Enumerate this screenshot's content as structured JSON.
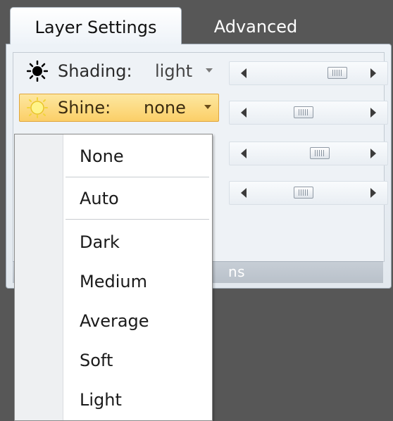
{
  "tabs": [
    {
      "label": "Layer Settings",
      "active": true
    },
    {
      "label": "Advanced",
      "active": false
    }
  ],
  "properties": {
    "shading": {
      "label": "Shading:",
      "value": "light",
      "icon": "black-sun-icon"
    },
    "shine": {
      "label": "Shine:",
      "value": "none",
      "icon": "yellow-sun-icon",
      "highlighted": true
    }
  },
  "sliders": [
    {
      "name": "shading-slider",
      "position": 0.8
    },
    {
      "name": "shine-slider",
      "position": 0.45
    },
    {
      "name": "slider-3",
      "position": 0.62
    },
    {
      "name": "slider-4",
      "position": 0.45
    }
  ],
  "panel": {
    "footer_visible_text": "ns"
  },
  "dropdown": {
    "items": [
      "None",
      "Auto",
      "Dark",
      "Medium",
      "Average",
      "Soft",
      "Light"
    ],
    "separators_after": [
      0,
      1
    ]
  },
  "colors": {
    "highlight": "#fbcf68",
    "background": "#575757",
    "panel": "#e8edf2"
  }
}
